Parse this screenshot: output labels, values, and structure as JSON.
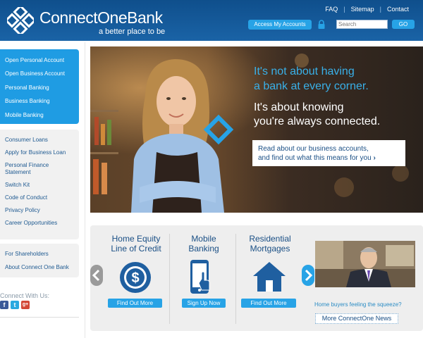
{
  "header": {
    "logo_name": "ConnectOne",
    "logo_suffix": "Bank",
    "tagline": "a better place to be",
    "top_links": [
      "FAQ",
      "Sitemap",
      "Contact"
    ],
    "access_button": "Access My Accounts",
    "search_placeholder": "Search",
    "go_button": "GO"
  },
  "sidebar": {
    "primary_nav": [
      "Open Personal Account",
      "Open Business Account",
      "Personal Banking",
      "Business Banking",
      "Mobile Banking"
    ],
    "secondary_nav": [
      "Consumer Loans",
      "Apply for Business Loan",
      "Personal Finance",
      "Statement",
      "Switch Kit",
      "Code of Conduct",
      "Privacy Policy",
      "Career Opportunities"
    ],
    "tertiary_nav": [
      "For Shareholders",
      "About Connect One Bank"
    ],
    "connect_label": "Connect With Us:",
    "social": [
      {
        "icon": "facebook-icon",
        "glyph": "f",
        "color": "#3b5998"
      },
      {
        "icon": "twitter-icon",
        "glyph": "t",
        "color": "#2aa9e0"
      },
      {
        "icon": "googleplus-icon",
        "glyph": "g+",
        "color": "#d34836"
      }
    ]
  },
  "hero": {
    "line1": "It's not about having",
    "line2": "a bank at every corner.",
    "line3": "It's about knowing",
    "line4": "you're always connected.",
    "cta_line1": "Read about our business accounts,",
    "cta_line2": "and find out what this means for you",
    "cta_arrow": "›"
  },
  "promo": {
    "columns": [
      {
        "title_line1": "Home Equity",
        "title_line2": "Line of Credit",
        "icon": "dollar-icon",
        "button": "Find Out More"
      },
      {
        "title_line1": "Mobile",
        "title_line2": "Banking",
        "icon": "smartphone-icon",
        "button": "Sign Up Now"
      },
      {
        "title_line1": "Residential",
        "title_line2": "Mortgages",
        "icon": "house-icon",
        "button": "Find Out More"
      }
    ],
    "news_question": "Home buyers feeling the squeeze?",
    "news_button": "More ConnectOne News"
  },
  "colors": {
    "header_blue": "#1a63a6",
    "accent_blue": "#27a3e6",
    "nav_blue": "#1f9ce3",
    "link_blue": "#1a4f85"
  }
}
